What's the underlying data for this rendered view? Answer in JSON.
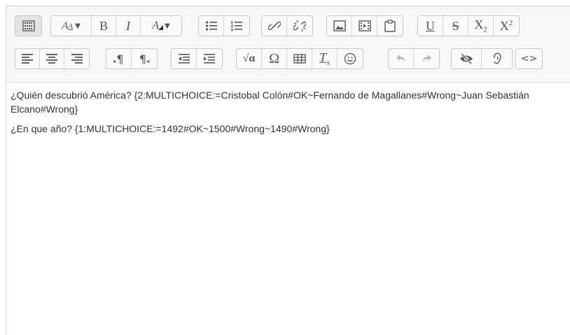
{
  "toolbar": {
    "font_size_glyph": "A",
    "font_size_sub": "A",
    "bold": "B",
    "italic": "I",
    "font_color_glyph": "A",
    "underline": "U",
    "strike": "S",
    "subscript_base": "X",
    "subscript_index": "2",
    "superscript_base": "X",
    "superscript_index": "2",
    "clear_format_base": "T",
    "clear_format_index": "x",
    "equation": "√α",
    "special_char": "Ω",
    "code": "<>"
  },
  "content": {
    "paragraphs": [
      "¿Quién descubrió América? {2:MULTICHOICE:=Cristobal Colón#OK~Fernando de Magallanes#Wrong~Juan Sebastián Elcano#Wrong}",
      "¿En que año? {1:MULTICHOICE:=1492#OK~1500#Wrong~1490#Wrong}"
    ]
  },
  "colors": {
    "toolbar_bg": "#f7f7f7",
    "button_icon": "#555555",
    "disabled_icon": "#b8b8b8",
    "text": "#333333"
  }
}
